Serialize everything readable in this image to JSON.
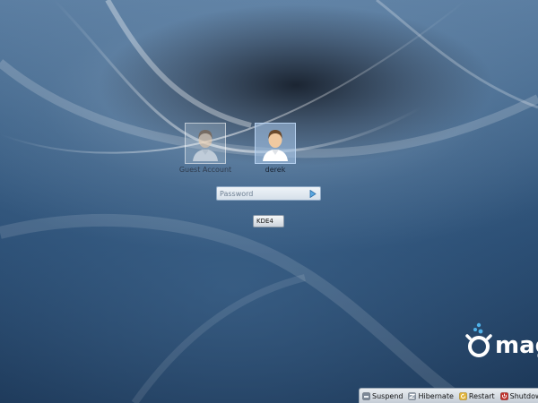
{
  "users": [
    {
      "name": "Guest Account",
      "selected": false
    },
    {
      "name": "derek",
      "selected": true
    }
  ],
  "login": {
    "password_placeholder": "Password",
    "session": "KDE4"
  },
  "branding": {
    "logo_text": "mag"
  },
  "power": {
    "suspend": "Suspend",
    "hibernate": "Hibernate",
    "restart": "Restart",
    "shutdown": "Shutdown"
  },
  "colors": {
    "background": "#2a4d73",
    "accent": "#5aa8e0",
    "shutdown_icon": "#c0302a"
  },
  "icons": {
    "user": "user-avatar-icon",
    "go": "go-arrow-icon",
    "suspend": "suspend-icon",
    "hibernate": "hibernate-icon",
    "restart": "restart-icon",
    "shutdown": "shutdown-icon"
  }
}
